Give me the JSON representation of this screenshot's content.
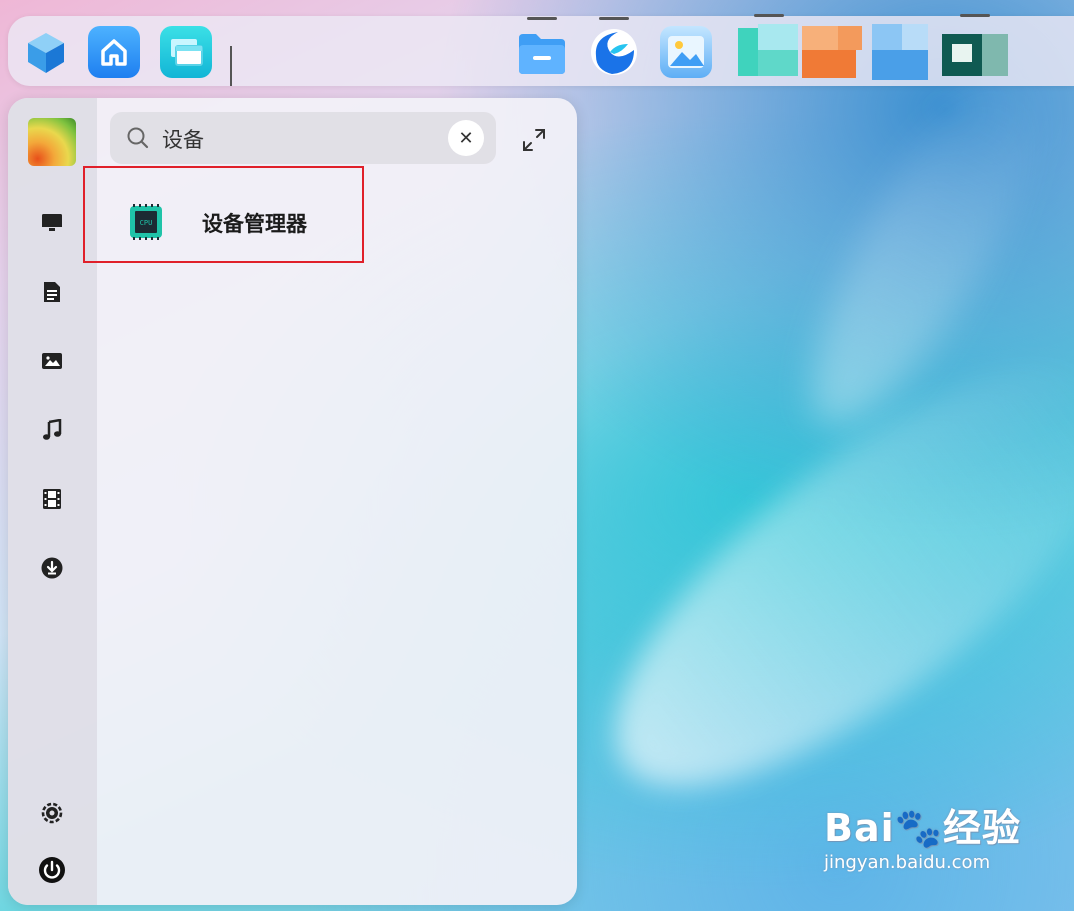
{
  "taskbar": {
    "pinned": [
      {
        "name": "start-cube",
        "icon": "cube-icon"
      },
      {
        "name": "home",
        "icon": "home-icon"
      },
      {
        "name": "multitask",
        "icon": "window-stack-icon"
      }
    ],
    "running": [
      {
        "name": "file-manager",
        "icon": "folder-icon"
      },
      {
        "name": "browser",
        "icon": "browser-swirl-icon"
      },
      {
        "name": "image-viewer",
        "icon": "image-icon"
      }
    ],
    "blurred_apps_count": 4
  },
  "start_menu": {
    "search": {
      "value": "设备",
      "placeholder": ""
    },
    "clear_glyph": "✕",
    "rail_items": [
      {
        "name": "computer",
        "icon": "monitor-icon"
      },
      {
        "name": "documents",
        "icon": "document-icon"
      },
      {
        "name": "pictures",
        "icon": "picture-icon"
      },
      {
        "name": "music",
        "icon": "music-note-icon"
      },
      {
        "name": "videos",
        "icon": "film-icon"
      },
      {
        "name": "downloads",
        "icon": "download-icon"
      },
      {
        "name": "settings",
        "icon": "gear-icon"
      },
      {
        "name": "power",
        "icon": "power-icon"
      }
    ],
    "results": [
      {
        "label": "设备管理器",
        "icon": "cpu-chip-icon",
        "icon_text": "CPU"
      }
    ]
  },
  "watermark": {
    "logo": "Bai🐾经验",
    "url": "jingyan.baidu.com"
  },
  "colors": {
    "highlight_border": "#e0202a",
    "accent_blue": "#2b8cf0",
    "chip_teal": "#1fc3a8"
  }
}
